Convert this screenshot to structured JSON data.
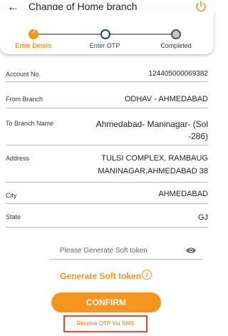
{
  "header": {
    "title": "Change of Home branch",
    "back_icon": "arrow-left-icon",
    "power_icon": "power-icon"
  },
  "stepper": {
    "steps": [
      {
        "label": "Enter Details",
        "state": "completed"
      },
      {
        "label": "Enter OTP",
        "state": "current"
      },
      {
        "label": "Completed",
        "state": "pending"
      }
    ]
  },
  "form": {
    "account_no": {
      "label": "Account No.",
      "value": "124405000069382"
    },
    "from_branch": {
      "label": "From Branch",
      "value": "ODHAV - AHMEDABAD"
    },
    "to_branch": {
      "label": "To Branch Name",
      "value_line1": "Ahmedabad- Maninagar- (Sol",
      "value_line2": "-286)"
    },
    "address": {
      "label": "Address",
      "value_line1": "TULSI COMPLEX, RAMBAUG",
      "value_line2": "MANINAGAR,AHMEDABAD 38"
    },
    "city": {
      "label": "City",
      "value": "AHMEDABAD"
    },
    "state": {
      "label": "State",
      "value": "GJ"
    }
  },
  "soft_token": {
    "placeholder": "Please Generate Soft token",
    "generate_label": "Generate Soft token"
  },
  "confirm_label": "CONFIRM",
  "sms_link": "Receive OTP Via SMS",
  "colors": {
    "accent": "#f7941d",
    "current_step": "#1f4e4a",
    "highlight_box": "#e0463a"
  }
}
